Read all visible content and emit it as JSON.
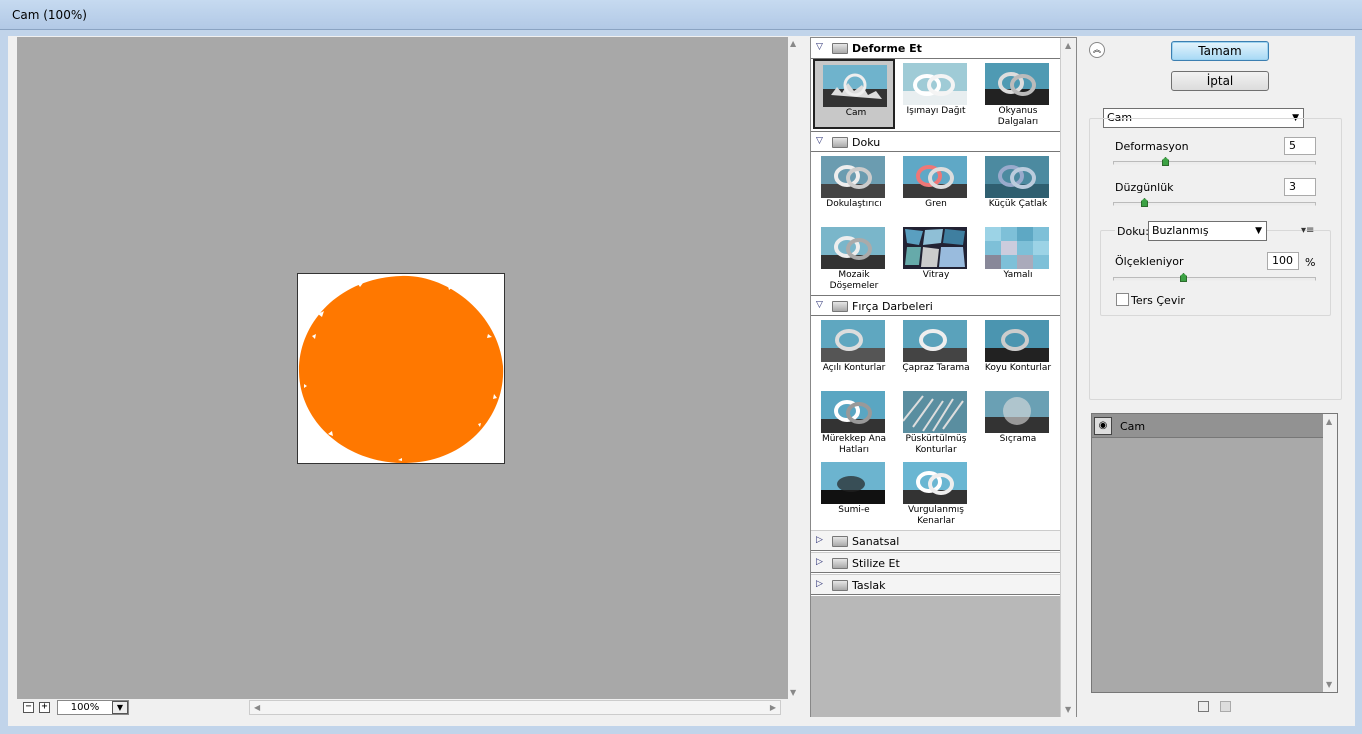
{
  "window": {
    "title": "Cam (100%)"
  },
  "preview": {
    "zoom": "100%",
    "zoom_out": "−",
    "zoom_in": "+",
    "image_color": "#ff7800"
  },
  "gallery": {
    "categories": [
      {
        "label": "Deforme Et",
        "expanded": true,
        "items": [
          "Cam",
          "Işımayı Dağıt",
          "Okyanus Dalgaları"
        ]
      },
      {
        "label": "Doku",
        "expanded": true,
        "items": [
          "Dokulaştırıcı",
          "Gren",
          "Küçük Çatlak",
          "Mozaik Döşemeler",
          "Vitray",
          "Yamalı"
        ]
      },
      {
        "label": "Fırça Darbeleri",
        "expanded": true,
        "items": [
          "Açılı Konturlar",
          "Çapraz Tarama",
          "Koyu Konturlar",
          "Mürekkep Ana Hatları",
          "Püskürtülmüş Konturlar",
          "Sıçrama",
          "Sumi-e",
          "Vurgulanmış Kenarlar"
        ]
      },
      {
        "label": "Sanatsal",
        "expanded": false
      },
      {
        "label": "Stilize Et",
        "expanded": false
      },
      {
        "label": "Taslak",
        "expanded": false
      }
    ],
    "selected": "Cam"
  },
  "buttons": {
    "ok": "Tamam",
    "cancel": "İptal"
  },
  "settings": {
    "filter": "Cam",
    "distortion": {
      "label": "Deformasyon",
      "value": "5",
      "level": 0.25
    },
    "smoothness": {
      "label": "Düzgünlük",
      "value": "3",
      "level": 0.15
    },
    "texture": {
      "label": "Doku:",
      "value": "Buzlanmış"
    },
    "scaling": {
      "label": "Ölçekleniyor",
      "value": "100",
      "unit": "%",
      "level": 0.35
    },
    "invert": {
      "label": "Ters Çevir",
      "checked": false
    }
  },
  "layers": [
    {
      "name": "Cam",
      "visible": true
    }
  ],
  "icons": {
    "expand_collapse": "double-chevron-up-icon",
    "new_layer": "new-effect-layer-icon",
    "delete": "trash-icon",
    "eye": "eye-icon",
    "folder": "folder-icon"
  }
}
